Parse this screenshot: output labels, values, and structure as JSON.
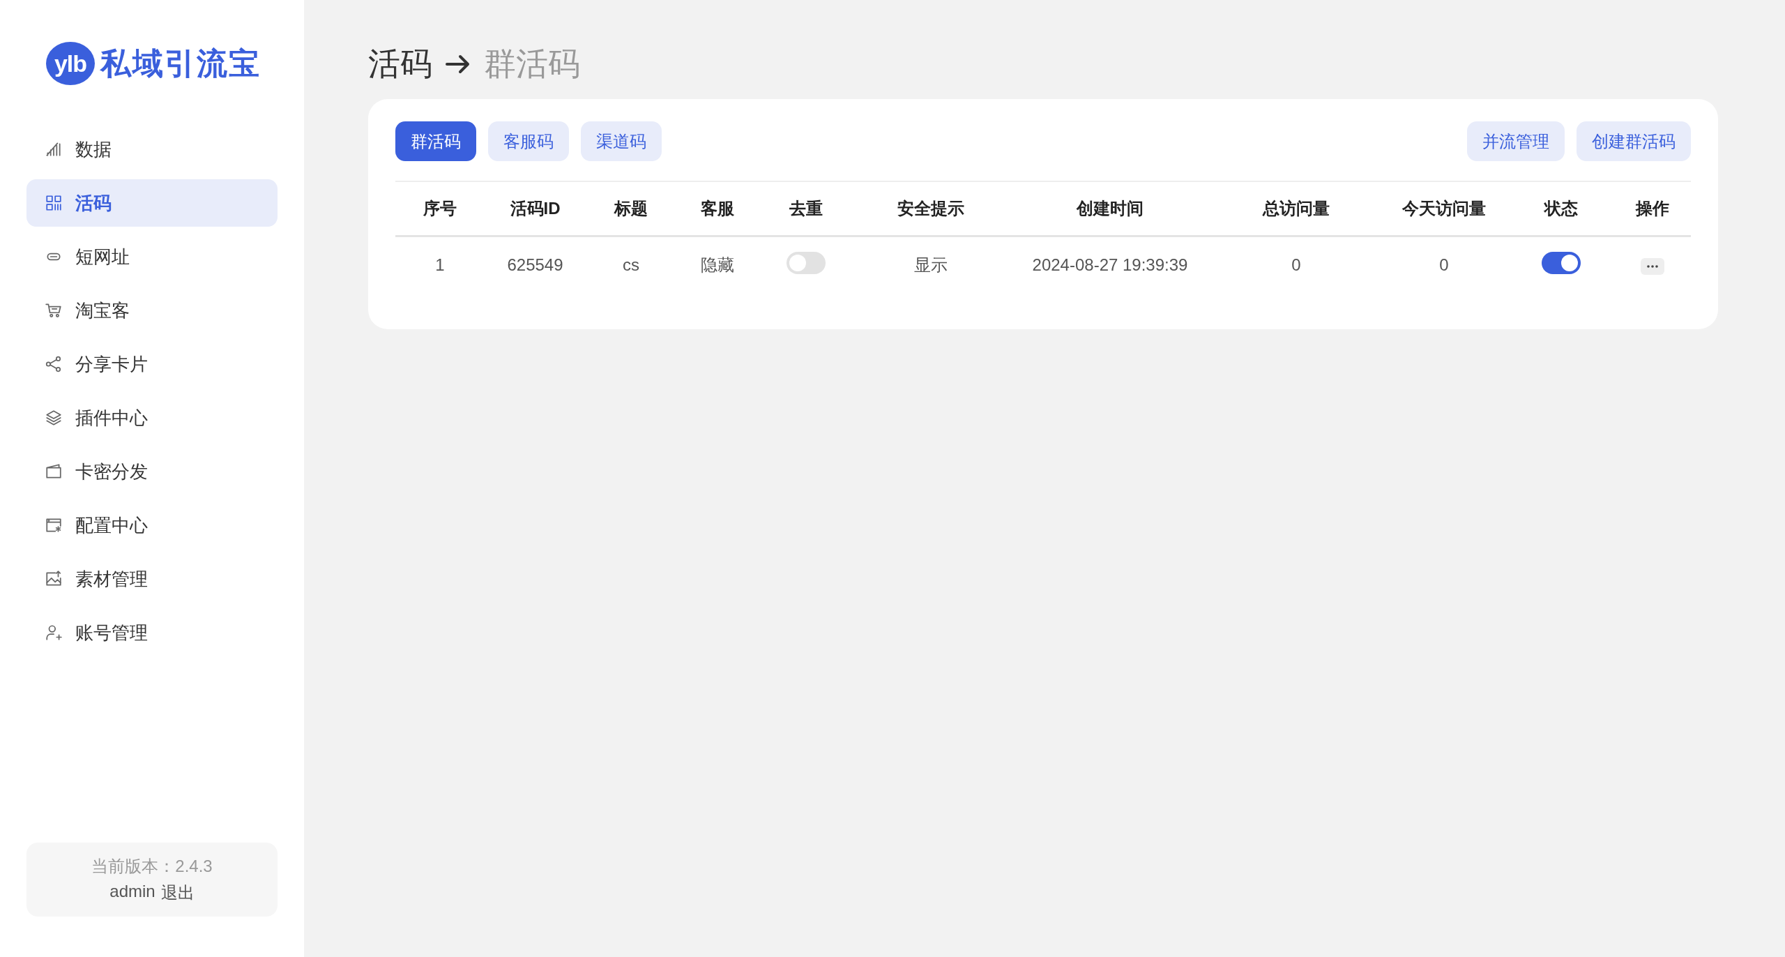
{
  "sidebar": {
    "logo": {
      "badge": "ylb",
      "name": "私域引流宝"
    },
    "items": [
      {
        "label": "数据",
        "selected": false
      },
      {
        "label": "活码",
        "selected": true
      },
      {
        "label": "短网址",
        "selected": false
      },
      {
        "label": "淘宝客",
        "selected": false
      },
      {
        "label": "分享卡片",
        "selected": false
      },
      {
        "label": "插件中心",
        "selected": false
      },
      {
        "label": "卡密分发",
        "selected": false
      },
      {
        "label": "配置中心",
        "selected": false
      },
      {
        "label": "素材管理",
        "selected": false
      },
      {
        "label": "账号管理",
        "selected": false
      }
    ],
    "footer": {
      "version": "当前版本：2.4.3",
      "user": "admin",
      "logout": "退出"
    }
  },
  "breadcrumb": {
    "parent": "活码",
    "current": "群活码"
  },
  "tabs": [
    {
      "label": "群活码",
      "selected": true
    },
    {
      "label": "客服码",
      "selected": false
    },
    {
      "label": "渠道码",
      "selected": false
    }
  ],
  "actions": [
    "并流管理",
    "创建群活码"
  ],
  "table": {
    "columns": [
      "序号",
      "活码ID",
      "标题",
      "客服",
      "去重",
      "安全提示",
      "创建时间",
      "总访问量",
      "今天访问量",
      "状态",
      "操作"
    ],
    "rows": [
      {
        "cells": [
          {
            "kind": "text",
            "text": "1"
          },
          {
            "kind": "text",
            "text": "625549"
          },
          {
            "kind": "text",
            "text": "cs"
          },
          {
            "kind": "text",
            "text": "隐藏"
          },
          {
            "kind": "toggle",
            "on": false
          },
          {
            "kind": "text",
            "text": "显示"
          },
          {
            "kind": "text",
            "text": "2024-08-27 19:39:39"
          },
          {
            "kind": "text",
            "text": "0"
          },
          {
            "kind": "text",
            "text": "0"
          },
          {
            "kind": "toggle",
            "on": true
          },
          {
            "kind": "menu"
          }
        ]
      }
    ]
  }
}
